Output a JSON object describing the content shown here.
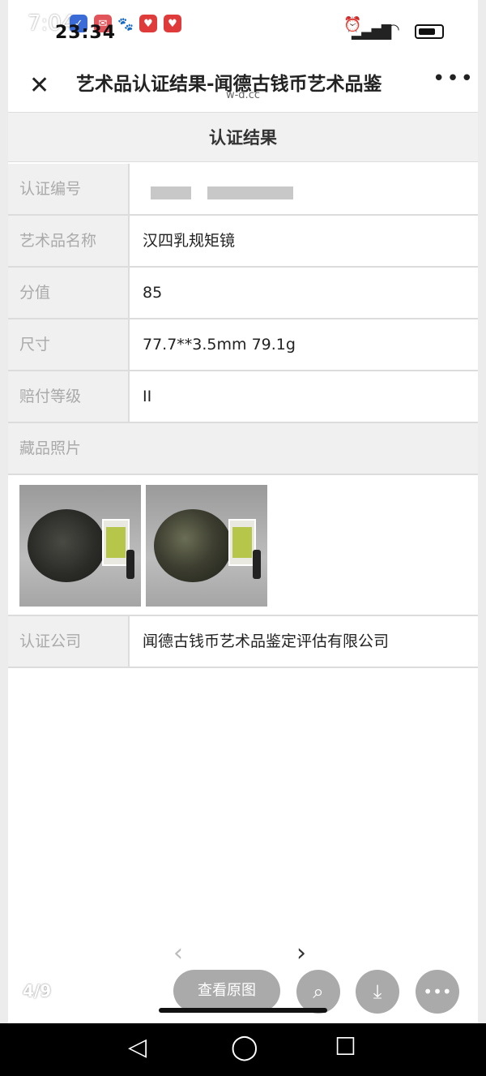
{
  "status": {
    "time_overlay": "7:04",
    "time_page": "23:34"
  },
  "header": {
    "title": "艺术品认证结果-闻德古钱币艺术品鉴",
    "domain": "w-d.cc"
  },
  "section_title": "认证结果",
  "fields": [
    {
      "label": "认证编号",
      "value": ""
    },
    {
      "label": "艺术品名称",
      "value": "汉四乳规矩镜"
    },
    {
      "label": "分值",
      "value": "85"
    },
    {
      "label": "尺寸",
      "value": "77.7**3.5mm 79.1g"
    },
    {
      "label": "赔付等级",
      "value": "II"
    }
  ],
  "photos_label": "藏品照片",
  "company": {
    "label": "认证公司",
    "value": "闻德古钱币艺术品鉴定评估有限公司"
  },
  "viewer": {
    "pager": "4/9",
    "view_original": "查看原图"
  },
  "icons": [
    "close-icon",
    "more-icon",
    "chevron-left-icon",
    "chevron-right-icon",
    "scan-icon",
    "download-icon",
    "ellipsis-icon",
    "back-icon",
    "home-icon",
    "recents-icon"
  ]
}
